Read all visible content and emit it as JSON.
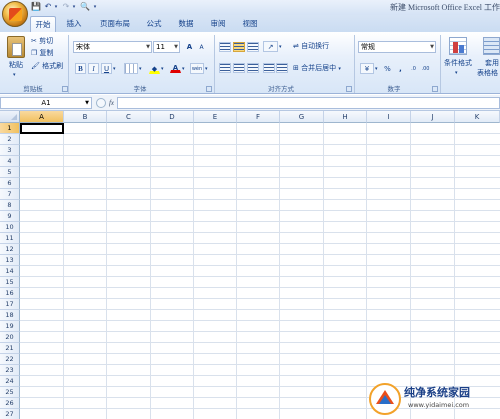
{
  "window": {
    "title": "新建 Microsoft Office Excel 工作"
  },
  "tabs": [
    "开始",
    "插入",
    "页面布局",
    "公式",
    "数据",
    "审阅",
    "视图"
  ],
  "ribbon": {
    "clipboard": {
      "paste": "粘贴",
      "cut": "剪切",
      "copy": "复制",
      "format_painter": "格式刷",
      "label": "剪贴板"
    },
    "font": {
      "name": "宋体",
      "size": "11",
      "label": "字体",
      "bold": "B",
      "italic": "I",
      "underline": "U",
      "grow": "A",
      "shrink": "A",
      "color_letter": "A",
      "phonetic": "wén"
    },
    "alignment": {
      "wrap": "自动换行",
      "merge": "合并后居中",
      "label": "对齐方式"
    },
    "number": {
      "format": "常规",
      "label": "数字",
      "percent": "%",
      "comma": ","
    },
    "styles": {
      "cond_format": "条件格式",
      "table_format": "套用",
      "table_format2": "表格格"
    }
  },
  "formula_bar": {
    "name_box": "A1",
    "fx": "fx",
    "value": ""
  },
  "grid": {
    "columns": [
      "A",
      "B",
      "C",
      "D",
      "E",
      "F",
      "G",
      "H",
      "I",
      "J",
      "K"
    ],
    "rows": [
      "1",
      "2",
      "3",
      "4",
      "5",
      "6",
      "7",
      "8",
      "9",
      "10",
      "11",
      "12",
      "13",
      "14",
      "15",
      "16",
      "17",
      "18",
      "19",
      "20",
      "21",
      "22",
      "23",
      "24",
      "25",
      "26",
      "27"
    ],
    "selected_cell": "A1"
  },
  "watermark": {
    "brand": "纯净系统家园",
    "url": "www.yidaimei.com"
  },
  "colors": {
    "accent": "#15428b",
    "ribbon_bg": "#dbe7f6",
    "selected_header": "#f6c86a"
  }
}
